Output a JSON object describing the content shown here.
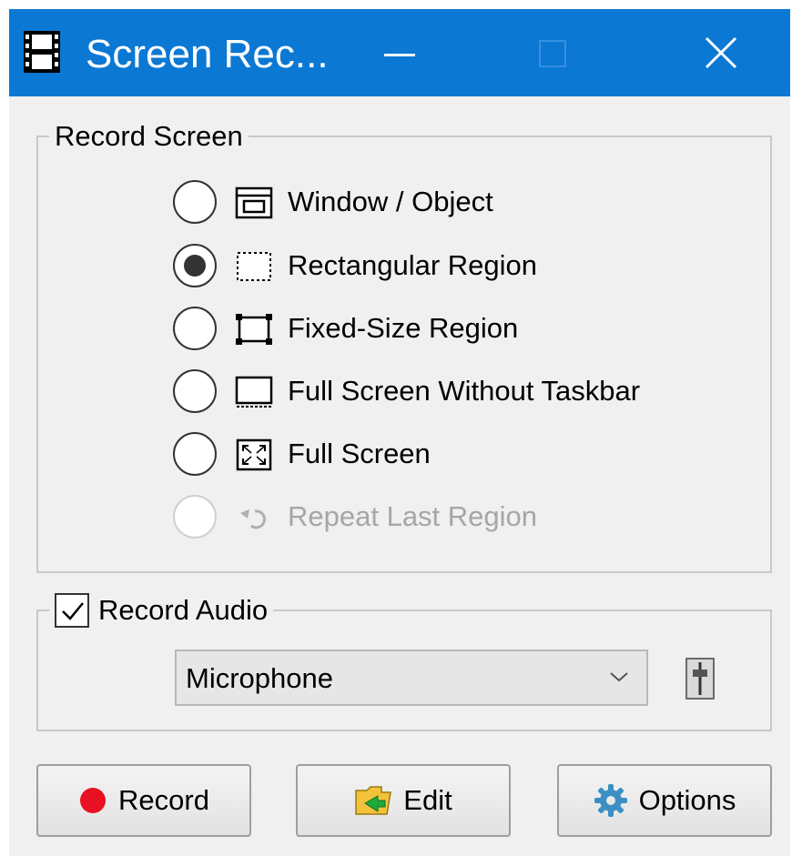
{
  "window": {
    "title": "Screen Rec...",
    "app_icon": "film-strip-icon",
    "controls": [
      "minimize-icon",
      "maximize-icon",
      "close-icon"
    ],
    "accent_color": "#0b78d4"
  },
  "record_screen": {
    "legend": "Record Screen",
    "selected": "Rectangular Region",
    "options": [
      {
        "label": "Window / Object",
        "icon": "window-icon",
        "checked": false,
        "enabled": true
      },
      {
        "label": "Rectangular Region",
        "icon": "dotted-rectangle-icon",
        "checked": true,
        "enabled": true
      },
      {
        "label": "Fixed-Size Region",
        "icon": "fixed-region-icon",
        "checked": false,
        "enabled": true
      },
      {
        "label": "Full Screen Without Taskbar",
        "icon": "screen-without-taskbar-icon",
        "checked": false,
        "enabled": true
      },
      {
        "label": "Full Screen",
        "icon": "fullscreen-icon",
        "checked": false,
        "enabled": true
      },
      {
        "label": "Repeat Last Region",
        "icon": "repeat-icon",
        "checked": false,
        "enabled": false
      }
    ]
  },
  "record_audio": {
    "label": "Record Audio",
    "checked": true,
    "device": "Microphone",
    "device_icon": "chevron-down-icon",
    "mixer_icon": "volume-mixer-icon"
  },
  "buttons": {
    "record": {
      "label": "Record",
      "icon": "record-dot-icon",
      "icon_color": "#e81123"
    },
    "edit": {
      "label": "Edit",
      "icon": "folder-edit-icon"
    },
    "options": {
      "label": "Options",
      "icon": "gear-icon"
    }
  }
}
